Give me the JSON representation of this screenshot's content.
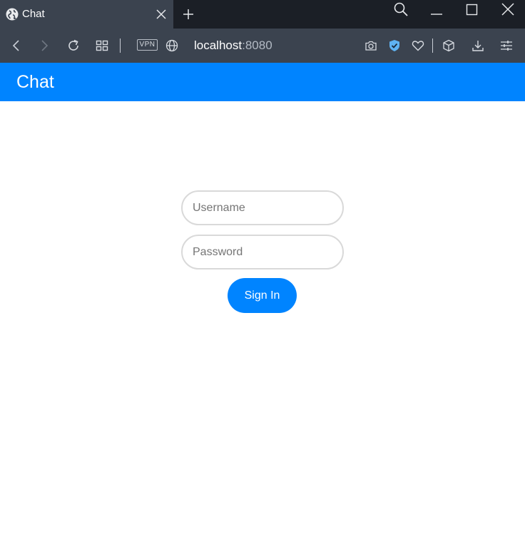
{
  "browser": {
    "tab": {
      "title": "Chat",
      "favicon": "globe-icon"
    },
    "address": {
      "host": "localhost",
      "port": ":8080"
    },
    "vpn_label": "VPN",
    "icons": [
      "back-icon",
      "forward-icon",
      "reload-icon",
      "tabs-grid-icon",
      "globe-icon",
      "camera-icon",
      "shield-check-icon",
      "heart-icon",
      "cube-icon",
      "download-icon",
      "sliders-icon",
      "search-icon",
      "minimize-icon",
      "maximize-icon",
      "close-icon",
      "plus-icon"
    ]
  },
  "app": {
    "title": "Chat",
    "accent_color": "#0084ff"
  },
  "login": {
    "username_placeholder": "Username",
    "password_placeholder": "Password",
    "signin_label": "Sign In"
  }
}
